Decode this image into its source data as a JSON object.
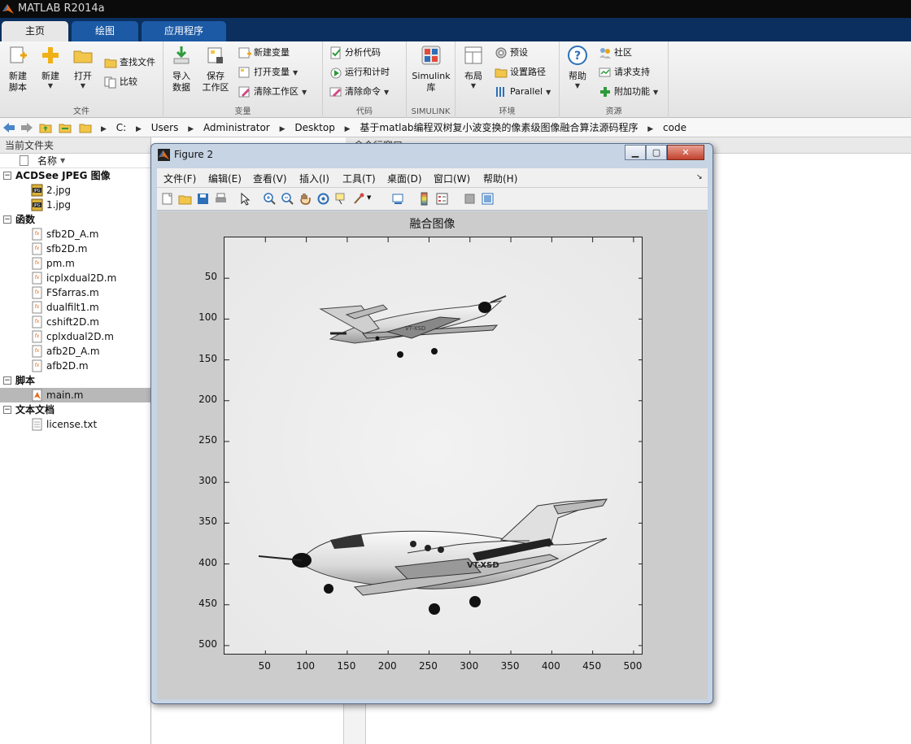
{
  "app": {
    "title": "MATLAB R2014a"
  },
  "tabs": [
    {
      "label": "主页",
      "active": true
    },
    {
      "label": "绘图",
      "active": false
    },
    {
      "label": "应用程序",
      "active": false
    }
  ],
  "ribbon": {
    "file": {
      "label": "文件",
      "new_script": "新建\n脚本",
      "new": "新建",
      "open": "打开",
      "find_files": "查找文件",
      "compare": "比较"
    },
    "variable": {
      "label": "变量",
      "import": "导入\n数据",
      "save_ws": "保存\n工作区",
      "new_var": "新建变量",
      "open_var": "打开变量",
      "clear_ws": "清除工作区"
    },
    "code": {
      "label": "代码",
      "analyze": "分析代码",
      "run_time": "运行和计时",
      "clear_cmd": "清除命令"
    },
    "simulink": {
      "label": "SIMULINK",
      "btn": "Simulink\n库"
    },
    "env": {
      "label": "环境",
      "layout": "布局",
      "prefs": "预设",
      "set_path": "设置路径",
      "parallel": "Parallel"
    },
    "resources": {
      "label": "资源",
      "help": "帮助",
      "community": "社区",
      "support": "请求支持",
      "addons": "附加功能"
    }
  },
  "address": {
    "crumbs": [
      "C:",
      "Users",
      "Administrator",
      "Desktop",
      "基于matlab编程双树复小波变换的像素级图像融合算法源码程序",
      "code"
    ]
  },
  "current_folder": {
    "title": "当前文件夹",
    "column_name": "名称",
    "groups": [
      {
        "name": "ACDSee JPEG 图像",
        "items": [
          "2.jpg",
          "1.jpg"
        ]
      },
      {
        "name": "函数",
        "items": [
          "sfb2D_A.m",
          "sfb2D.m",
          "pm.m",
          "icplxdual2D.m",
          "FSfarras.m",
          "dualfilt1.m",
          "cshift2D.m",
          "cplxdual2D.m",
          "afb2D_A.m",
          "afb2D.m"
        ]
      },
      {
        "name": "脚本",
        "items": [
          "main.m"
        ]
      },
      {
        "name": "文本文档",
        "items": [
          "license.txt"
        ]
      }
    ],
    "selected": "main.m"
  },
  "command_window": {
    "title": "命令行窗口"
  },
  "figure": {
    "title": "Figure 2",
    "menus": [
      "文件(F)",
      "编辑(E)",
      "查看(V)",
      "插入(I)",
      "工具(T)",
      "桌面(D)",
      "窗口(W)",
      "帮助(H)"
    ],
    "axes_title": "融合图像",
    "xticks": [
      "50",
      "100",
      "150",
      "200",
      "250",
      "300",
      "350",
      "400",
      "450",
      "500"
    ],
    "yticks": [
      "50",
      "100",
      "150",
      "200",
      "250",
      "300",
      "350",
      "400",
      "450",
      "500"
    ],
    "plane_label": "VT-XSD",
    "plane_label_small": "VT-XSD"
  },
  "colors": {
    "tab_bar": "#0b2f5e",
    "tab_inactive": "#1c5aa5",
    "titlebar": "#0b0b0b"
  }
}
